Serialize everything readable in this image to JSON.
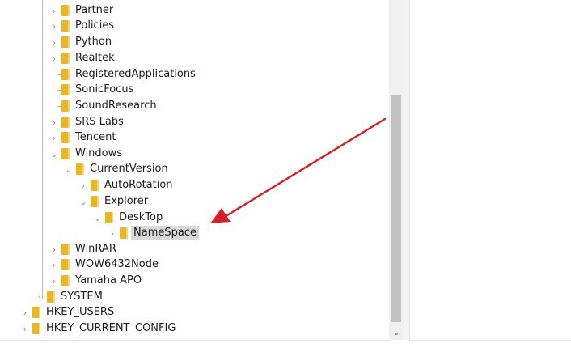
{
  "tree": {
    "rows": [
      {
        "label": "Partner",
        "expander": "›",
        "level": 1
      },
      {
        "label": "Policies",
        "expander": "›",
        "level": 1
      },
      {
        "label": "Python",
        "expander": "›",
        "level": 1
      },
      {
        "label": "Realtek",
        "expander": "›",
        "level": 1
      },
      {
        "label": "RegisteredApplications",
        "expander": "",
        "level": 1
      },
      {
        "label": "SonicFocus",
        "expander": "",
        "level": 1
      },
      {
        "label": "SoundResearch",
        "expander": "",
        "level": 1
      },
      {
        "label": "SRS Labs",
        "expander": "›",
        "level": 1
      },
      {
        "label": "Tencent",
        "expander": "›",
        "level": 1
      },
      {
        "label": "Windows",
        "expander": "⌄",
        "level": 1
      },
      {
        "label": "CurrentVersion",
        "expander": "⌄",
        "level": 2
      },
      {
        "label": "AutoRotation",
        "expander": "›",
        "level": 3
      },
      {
        "label": "Explorer",
        "expander": "⌄",
        "level": 3
      },
      {
        "label": "DeskTop",
        "expander": "⌄",
        "level": 4
      },
      {
        "label": "NameSpace",
        "expander": "›",
        "level": 5,
        "selected": true
      },
      {
        "label": "WinRAR",
        "expander": "›",
        "level": 1
      },
      {
        "label": "WOW6432Node",
        "expander": "›",
        "level": 1
      },
      {
        "label": "Yamaha APO",
        "expander": "›",
        "level": 1
      },
      {
        "label": "SYSTEM",
        "expander": "›",
        "level": 0
      },
      {
        "label": "HKEY_USERS",
        "expander": "›",
        "level": -1
      },
      {
        "label": "HKEY_CURRENT_CONFIG",
        "expander": "›",
        "level": -1
      }
    ]
  },
  "scrollbar": {
    "down_icon": "⌄"
  },
  "annotation": {
    "color": "#d42027"
  },
  "colors": {
    "folder": "#e8b728",
    "selected": "#d9d9d9"
  }
}
